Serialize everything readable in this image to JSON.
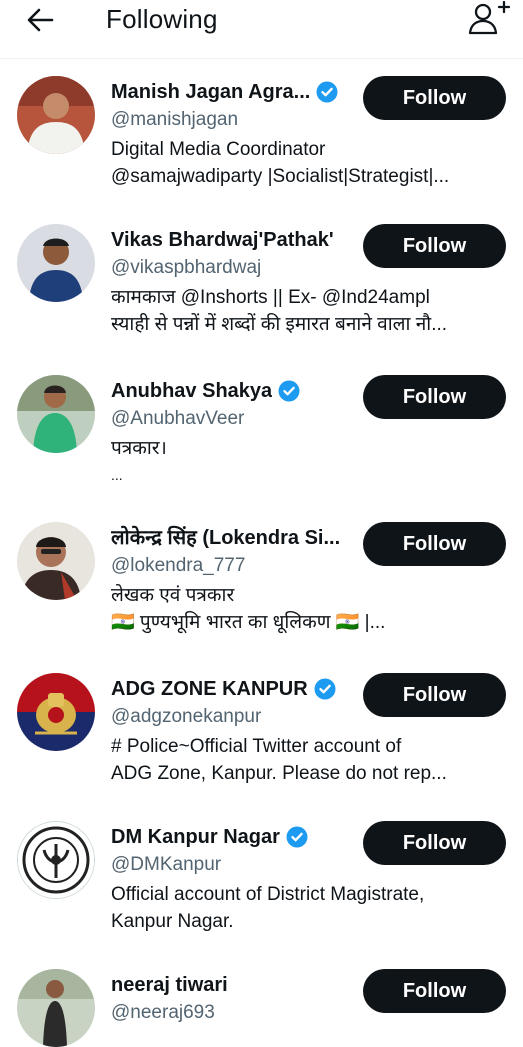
{
  "header": {
    "title": "Following",
    "back_icon": "back-arrow-icon",
    "add_icon": "add-person-icon"
  },
  "colors": {
    "verified": "#1d9bf0",
    "button": "#0f1419",
    "secondary_text": "#536471"
  },
  "users": [
    {
      "name": "Manish Jagan Agra...",
      "handle": "@manishjagan",
      "verified": true,
      "bio": [
        "Digital Media Coordinator",
        "@samajwadiparty |Socialist|Strategist|..."
      ],
      "button": "Follow"
    },
    {
      "name": "Vikas Bhardwaj'Pathak'",
      "handle": "@vikaspbhardwaj",
      "verified": false,
      "bio": [
        "कामकाज @Inshorts || Ex- @Ind24ampl",
        "स्याही से पन्नों में शब्दों की इमारत बनाने वाला नौ..."
      ],
      "button": "Follow"
    },
    {
      "name": "Anubhav Shakya",
      "handle": "@AnubhavVeer",
      "verified": true,
      "bio": [
        "पत्रकार।",
        "..."
      ],
      "button": "Follow"
    },
    {
      "name": "लोकेन्द्र सिंह (Lokendra Si...",
      "handle": "@lokendra_777",
      "verified": false,
      "bio": [
        "लेखक एवं पत्रकार",
        "🇮🇳 पुण्यभूमि भारत का धूलिकण 🇮🇳 |..."
      ],
      "button": "Follow"
    },
    {
      "name": "ADG ZONE KANPUR",
      "handle": "@adgzonekanpur",
      "verified": true,
      "bio": [
        "# Police~Official Twitter account of",
        "ADG Zone, Kanpur.  Please do not rep..."
      ],
      "button": "Follow"
    },
    {
      "name": "DM Kanpur Nagar",
      "handle": "@DMKanpur",
      "verified": true,
      "bio": [
        "Official account of District Magistrate,",
        "Kanpur Nagar."
      ],
      "button": "Follow"
    },
    {
      "name": "neeraj tiwari",
      "handle": "@neeraj693",
      "verified": false,
      "bio": [],
      "button": "Follow"
    }
  ]
}
